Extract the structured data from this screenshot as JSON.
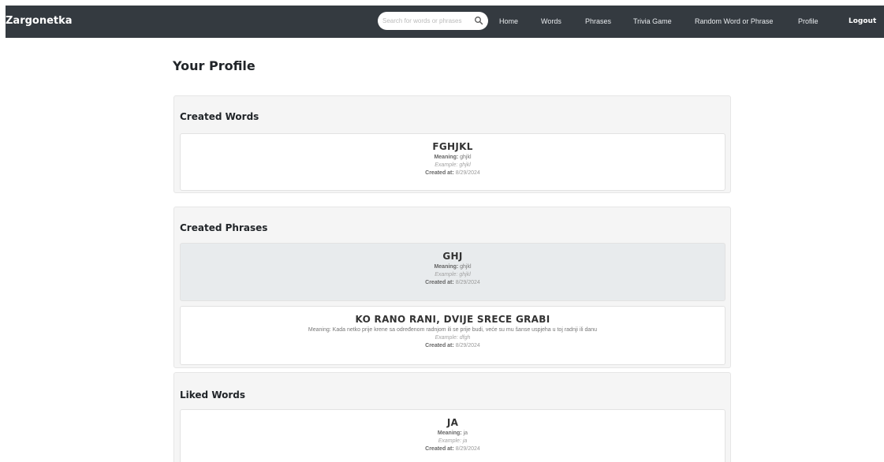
{
  "navbar": {
    "brand": "Zargonetka",
    "search_placeholder": "Search for words or phrases",
    "items": [
      "Home",
      "Words",
      "Phrases",
      "Trivia Game",
      "Random Word or Phrase",
      "Profile"
    ],
    "logout": "Logout"
  },
  "page": {
    "title": "Your Profile"
  },
  "labels": {
    "meaning": "Meaning:",
    "example": "Example:",
    "created": "Created at:"
  },
  "sections": {
    "created_words": {
      "title": "Created Words",
      "items": [
        {
          "title": "FGHJKL",
          "meaning": "ghjkl",
          "example": "ghjkl",
          "created": "8/29/2024"
        }
      ]
    },
    "created_phrases": {
      "title": "Created Phrases",
      "items": [
        {
          "title": "GHJ",
          "meaning": "ghjkl",
          "example": "ghjkl",
          "created": "8/29/2024"
        },
        {
          "title": "KO RANO RANI, DVIJE SRECE GRABI",
          "meaning": "Kada netko prije krene sa određenom radnjom ili se prije budi, veće su mu šanse uspjeha u toj radnji ili danu",
          "example": "dfgh",
          "created": "8/29/2024"
        }
      ]
    },
    "liked_words": {
      "title": "Liked Words",
      "items": [
        {
          "title": "JA",
          "meaning": "ja",
          "example": "ja",
          "created": "8/29/2024"
        }
      ]
    }
  },
  "colors": {
    "navbar_bg": "#343a40",
    "panel_bg": "#f5f5f5",
    "highlight_bg": "#e8ebed"
  }
}
